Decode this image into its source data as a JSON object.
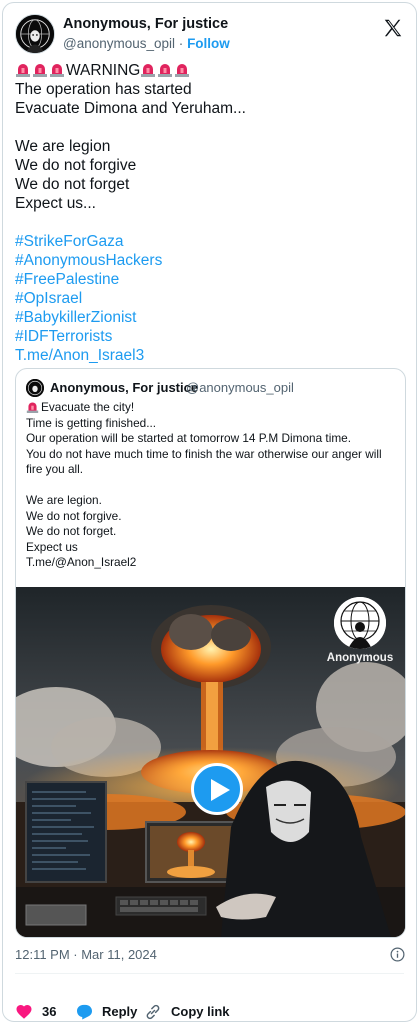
{
  "tweet": {
    "author_name": "Anonymous, For justice",
    "handle": "@anonymous_opil",
    "separator": "·",
    "follow_label": "Follow",
    "warning_word": "WARNING",
    "lines": [
      "The operation has started",
      "Evacuate Dimona and Yeruham...",
      "",
      "We are legion",
      "We do not forgive",
      "We do not forget",
      "Expect us...",
      ""
    ],
    "hashtags": [
      "#StrikeForGaza",
      "#AnonymousHackers",
      "#FreePalestine",
      "#OpIsrael",
      "#BabykillerZionist",
      "#IDFTerrorists",
      "T.me/Anon_Israel3"
    ],
    "timestamp": "12:11 PM · Mar 11, 2024"
  },
  "quoted_tweet": {
    "author_name": "Anonymous, For justice",
    "handle": "@anonymous_opil",
    "lines": [
      "Evacuate the city!",
      "Time is getting finished...",
      "Our operation will be started at tomorrow 14 P.M Dimona time.",
      "You do not have much time to finish the war otherwise our anger will fire you all.",
      "",
      "We are legion.",
      "We do not forgive.",
      "We do not forget.",
      "Expect us",
      "T.me/@Anon_Israel2"
    ],
    "media_watermark": "Anonymous"
  },
  "actions": {
    "like_count": "36",
    "reply_label": "Reply",
    "copy_link_label": "Copy link"
  },
  "icons": [
    "x-logo-icon",
    "siren-emoji-icon",
    "play-icon",
    "info-icon",
    "heart-icon",
    "reply-icon",
    "link-icon"
  ],
  "colors": {
    "link": "#1d9bf0",
    "like": "#f91880",
    "secondary_text": "#536471",
    "siren": "#e0245e"
  }
}
